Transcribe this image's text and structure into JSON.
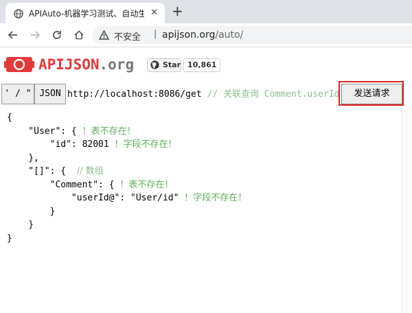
{
  "browser": {
    "tab_title": "APIAuto-机器学习测试、自动生",
    "tab_close": "✕",
    "new_tab": "+",
    "security_label": "不安全",
    "separator": "|",
    "url_host": "apijson.org",
    "url_path": "/auto/"
  },
  "header": {
    "brand_name": "APIJSON",
    "brand_suffix": ".org",
    "github_star_label": "Star",
    "github_star_count": "10,861"
  },
  "request": {
    "mode_label": "' / \"",
    "format_label": "JSON",
    "url": "http://localhost:8086/get",
    "url_comment": "  // 关联查询 Comment.userId = User.id",
    "send_label": "发送请求"
  },
  "editor_lines": [
    {
      "code": "{",
      "note": ""
    },
    {
      "code": "    \"User\": { ",
      "note": "！表不存在！"
    },
    {
      "code": "        \"id\": 82001 ",
      "note": "！字段不存在！"
    },
    {
      "code": "    },",
      "note": ""
    },
    {
      "code": "    \"[]\": {  ",
      "note": "// 数组"
    },
    {
      "code": "        \"Comment\": { ",
      "note": "！表不存在！"
    },
    {
      "code": "            \"userId@\": \"User/id\" ",
      "note": "！字段不存在！"
    },
    {
      "code": "        }",
      "note": ""
    },
    {
      "code": "    }",
      "note": ""
    },
    {
      "code": "}",
      "note": ""
    }
  ],
  "colors": {
    "accent": "#e5383b",
    "highlight_border": "#e02020",
    "comment_green": "#8fbc8f",
    "warning_green": "#5fae5f"
  }
}
